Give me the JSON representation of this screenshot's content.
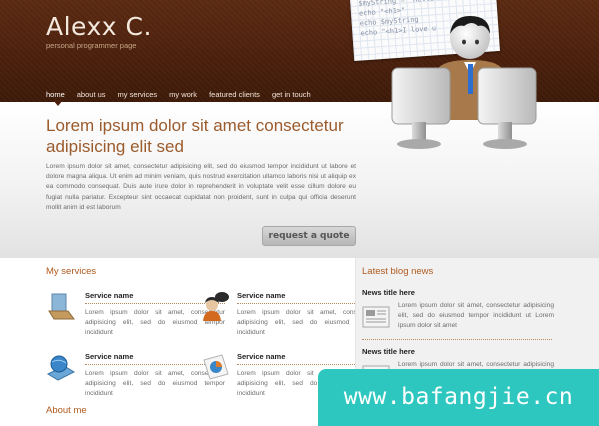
{
  "header": {
    "logo": "Alexx C.",
    "tagline": "personal programmer page",
    "nav": [
      "home",
      "about us",
      "my services",
      "my work",
      "featured clients",
      "get in touch"
    ],
    "code_lines": [
      "$myString = \"Hello",
      "echo \"<h1>\"",
      "echo $myString",
      "echo \"<h1>I love u"
    ]
  },
  "hero": {
    "title": "Lorem ipsum dolor sit amet consectetur adipisicing elit sed",
    "text": "Lorem ipsum dolor sit amet, consectetur adipisicing elit, sed do eiusmod tempor incididunt ut labore et dolore magna aliqua. Ut enim ad minim veniam, quis nostrud exercitation ullamco laboris nisi ut aliquip ex ea commodo consequat. Duis aute irure dolor in reprehenderit in voluptate velit esse cillum dolore eu fugiat nulla pariatur. Excepteur sint occaecat cupidatat non proident, sunt in culpa qui officia deserunt mollit anim id est laborum",
    "button": "request a quote"
  },
  "services": {
    "title": "My services",
    "items": [
      {
        "title": "Service name",
        "text": "Lorem ipsum dolor sit amet, consectetur adipisicing elit, sed do eiusmod tempor incididunt",
        "icon": "notebook-icon"
      },
      {
        "title": "Service name",
        "text": "Lorem ipsum dolor sit amet, consectetur adipisicing elit, sed do eiusmod tempor incididunt",
        "icon": "person-chat-icon"
      },
      {
        "title": "Service name",
        "text": "Lorem ipsum dolor sit amet, consectetur adipisicing elit, sed do eiusmod tempor incididunt",
        "icon": "globe-icon"
      },
      {
        "title": "Service name",
        "text": "Lorem ipsum dolor sit amet, consectetur adipisicing elit, sed do eiusmod tempor incididunt",
        "icon": "pie-chart-icon"
      }
    ]
  },
  "about": {
    "title": "About me"
  },
  "blog": {
    "title": "Latest blog news",
    "items": [
      {
        "title": "News title here",
        "text": "Lorem ipsum dolor sit amet, consectetur adipisicing elit, sed do eiusmod tempor incididunt ut Lorem ipsum dolor sit amet"
      },
      {
        "title": "News title here",
        "text": "Lorem ipsum dolor sit amet, consectetur adipisicing elit, sed do eiusmod tempor incididunt"
      }
    ]
  },
  "watermark": "www.bafangjie.cn",
  "colors": {
    "header_brown": "#4a200c",
    "accent_orange": "#b05a1e",
    "hero_title": "#9b5b2c",
    "watermark_teal": "#2ec7c0"
  }
}
